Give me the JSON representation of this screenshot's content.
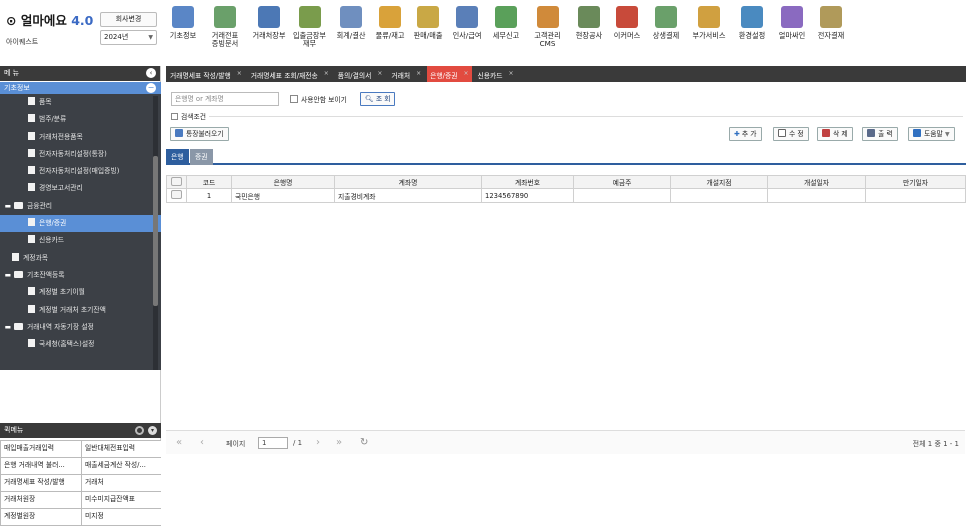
{
  "app": {
    "brand": "얼마에요",
    "version": "4.0",
    "company": "아이퀘스트",
    "company_change": "회사변경",
    "year": "2024년"
  },
  "top_menu": [
    {
      "label": "기초정보",
      "color": "#5a86c6"
    },
    {
      "label": "거래전표\n증빙문서",
      "color": "#6aa06a"
    },
    {
      "label": "거래처장부",
      "color": "#4c78b5"
    },
    {
      "label": "입출금장부\n재무",
      "color": "#7a9c4c"
    },
    {
      "label": "회계/결산",
      "color": "#6f8fbf"
    },
    {
      "label": "물류/재고",
      "color": "#d9a23a"
    },
    {
      "label": "판매/매출",
      "color": "#c9a845"
    },
    {
      "label": "인사/급여",
      "color": "#5a7fb8"
    },
    {
      "label": "세무신고",
      "color": "#5aa05a"
    },
    {
      "label": "고객관리\nCMS",
      "color": "#d08a3a"
    },
    {
      "label": "현장공사",
      "color": "#6a8a5a"
    },
    {
      "label": "이커머스",
      "color": "#c84a3a"
    },
    {
      "label": "상생결제",
      "color": "#6aa06a"
    },
    {
      "label": "부가서비스",
      "color": "#d0a040"
    },
    {
      "label": "환경설정",
      "color": "#4a8ac0"
    },
    {
      "label": "얼마싸인",
      "color": "#8a6ac0"
    },
    {
      "label": "전자결재",
      "color": "#b09a5a"
    }
  ],
  "sidebar": {
    "title": "메 뉴",
    "section": "기초정보",
    "items": [
      {
        "label": "품목",
        "type": "doc",
        "indent": 28
      },
      {
        "label": "범주/분류",
        "type": "doc",
        "indent": 28
      },
      {
        "label": "거래처전용품목",
        "type": "doc",
        "indent": 28
      },
      {
        "label": "전자자동처리설정(통장)",
        "type": "doc",
        "indent": 28
      },
      {
        "label": "전자자동처리설정(매입증빙)",
        "type": "doc",
        "indent": 28
      },
      {
        "label": "경영보고서관리",
        "type": "doc",
        "indent": 28
      },
      {
        "label": "금융관리",
        "type": "folder",
        "indent": 4
      },
      {
        "label": "은행/증권",
        "type": "doc",
        "indent": 28,
        "active": true
      },
      {
        "label": "신용카드",
        "type": "doc",
        "indent": 28
      },
      {
        "label": "계정과목",
        "type": "doc",
        "indent": 12
      },
      {
        "label": "기초잔액등록",
        "type": "folder",
        "indent": 4
      },
      {
        "label": "계정별 초기이월",
        "type": "doc",
        "indent": 28
      },
      {
        "label": "계정별 거래처 초기잔액",
        "type": "doc",
        "indent": 28
      },
      {
        "label": "거래내역 자동기장 설정",
        "type": "folder",
        "indent": 4
      },
      {
        "label": "국세청(홈택스)설정",
        "type": "doc",
        "indent": 28
      }
    ]
  },
  "quick_menu": {
    "title": "퀵메뉴",
    "items": [
      "매입매출거래입력",
      "일반대체전표입력",
      "은행 거래내역 불러...",
      "매출세금계산 작성/...",
      "거래명세표 작성/발행",
      "거래처",
      "거래처원장",
      "미수미지급잔액표",
      "계정별원장",
      "미지정"
    ]
  },
  "tabs": [
    {
      "label": "거래명세표 작성/발행"
    },
    {
      "label": "거래명세표 조회/재전송"
    },
    {
      "label": "품의/결의서"
    },
    {
      "label": "거래처"
    },
    {
      "label": "은행/증권",
      "active": true
    },
    {
      "label": "신용카드"
    }
  ],
  "search": {
    "placeholder": "은행명 or 계좌명",
    "unused_label": "사용안함 보이기",
    "search_btn": "조 회",
    "conditions": "검색조건"
  },
  "toolbar": {
    "passbook_btn": "통장불러오기",
    "add": "추 가",
    "edit": "수 정",
    "delete": "삭 제",
    "print": "출 력",
    "help": "도움말"
  },
  "subtabs": [
    "은행",
    "증권"
  ],
  "table": {
    "headers": [
      "",
      "코드",
      "은행명",
      "계좌명",
      "계좌번호",
      "예금주",
      "개설지점",
      "개설일자",
      "만기일자"
    ],
    "rows": [
      [
        "",
        "1",
        "국민은행",
        "지출경비계좌",
        "1234567890",
        "",
        "",
        "",
        ""
      ]
    ]
  },
  "pager": {
    "page_label": "페이지",
    "page": "1",
    "total_pages": "/ 1",
    "summary": "전체 1 중 1 - 1"
  }
}
